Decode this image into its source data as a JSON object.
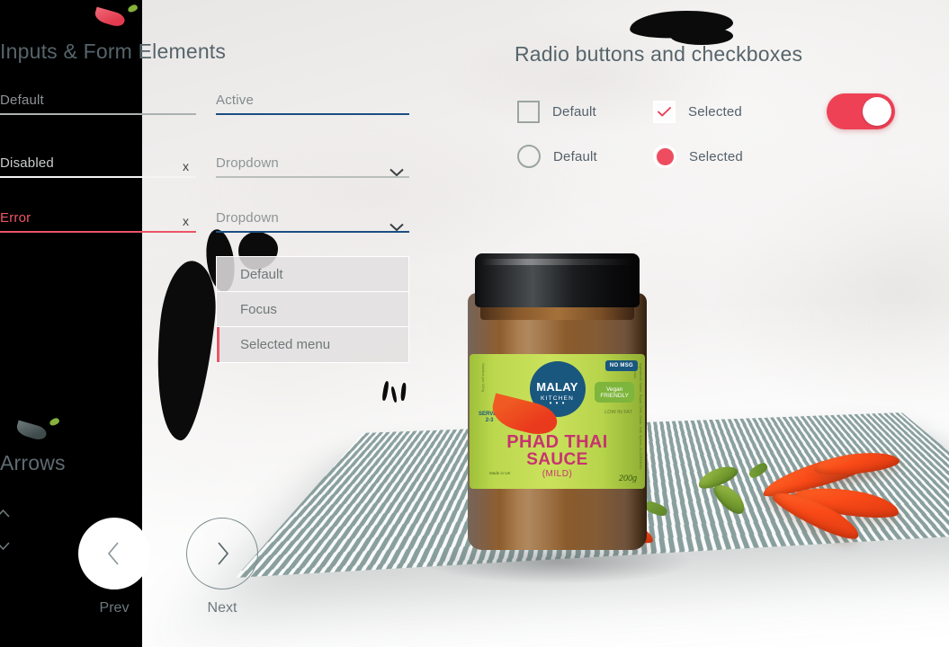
{
  "sections": {
    "inputs_title": "Inputs & Form Elements",
    "radio_title": "Radio buttons and checkboxes",
    "arrows_title": "Arrows"
  },
  "icons": {
    "chili_top": "chili-pepper-icon",
    "chili_arrows": "chili-pepper-icon"
  },
  "fields": {
    "default": {
      "value": "Default",
      "state": "default"
    },
    "disabled": {
      "value": "Disabled",
      "state": "disabled",
      "clear": "x"
    },
    "error": {
      "value": "Error",
      "state": "error",
      "clear": "x"
    },
    "active": {
      "value": "Active",
      "state": "active"
    },
    "dropdown1": {
      "value": "Dropdown",
      "state": "default"
    },
    "dropdown2": {
      "value": "Dropdown",
      "state": "active"
    }
  },
  "dropdown_menu": {
    "items": [
      {
        "label": "Default",
        "state": "default"
      },
      {
        "label": "Focus",
        "state": "focus"
      },
      {
        "label": "Selected menu",
        "state": "selected"
      }
    ]
  },
  "controls": {
    "checkbox_default": "Default",
    "checkbox_selected": "Selected",
    "radio_default": "Default",
    "radio_selected": "Selected",
    "toggle_state": "on"
  },
  "arrows": {
    "prev_label": "Prev",
    "next_label": "Next"
  },
  "product": {
    "brand": "MALAY",
    "brand_sub": "KITCHEN",
    "brand_dots": "• • •",
    "name_line1": "PHAD THAI",
    "name_line2": "SAUCE",
    "strength": "(MILD)",
    "weight": "200g",
    "badge_nomsg": "NO MSG",
    "badge_vegan_line1": "Vegan",
    "badge_vegan_line2": "FRIENDLY",
    "badge_lowfat": "LOW IN FAT",
    "badge_serves_line1": "SERVES",
    "badge_serves_line2": "2-3",
    "made_in": "Made in UK",
    "side_text_left": "Nutrition per 100g",
    "side_text_right": "Ingredients: Water, Sugar, Chilli, Garlic, Salt, Spices. ALLERGENS: See back."
  },
  "colors": {
    "error": "#ec5565",
    "active": "#1b4f82",
    "accent_red": "#ee4156",
    "panel_dark": "#000000",
    "label_green": "#bcd84f",
    "brand_blue": "#19577f",
    "product_pink": "#c7336f"
  }
}
